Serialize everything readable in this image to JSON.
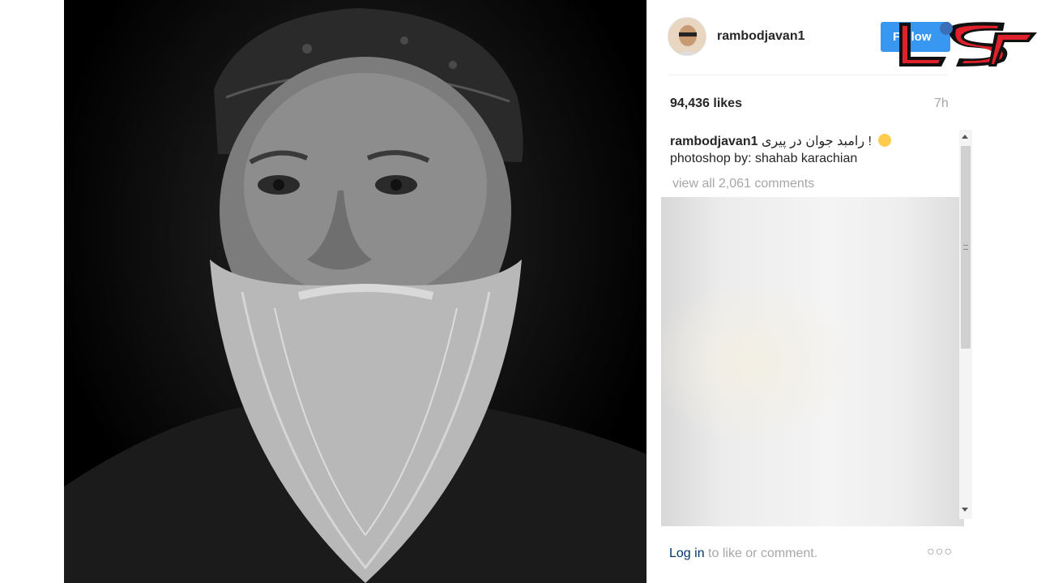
{
  "post": {
    "username": "rambodjavan1",
    "follow_label": "Follow",
    "likes": "94,436 likes",
    "time": "7h",
    "caption_user": "rambodjavan1",
    "caption_text": "رامبد جوان در پیری !",
    "caption_line2": "photoshop by: shahab karachian",
    "view_all": "view all 2,061 comments",
    "login_link": "Log in",
    "login_rest": " to like or comment.",
    "more_label": "○○○"
  },
  "colors": {
    "follow_bg": "#3897f0",
    "logo_red": "#e0202a",
    "muted_text": "#a5a7aa",
    "link": "#003569"
  },
  "icons": {
    "avatar": "profile-avatar",
    "emoji": "smirk-emoji-icon",
    "logo": "rokna-logo",
    "more": "ellipsis-icon"
  }
}
